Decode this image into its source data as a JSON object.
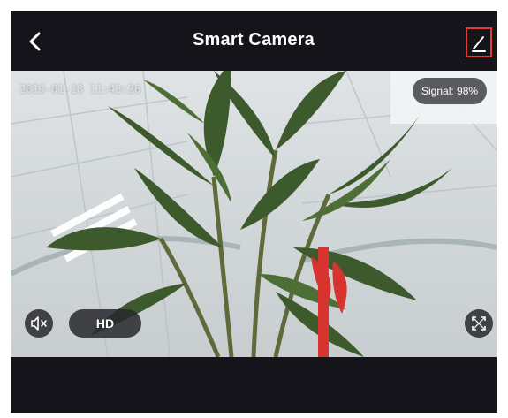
{
  "header": {
    "title": "Smart Camera",
    "back_icon": "chevron-left-icon",
    "edit_icon": "pencil-icon",
    "edit_highlight_color": "#e53935"
  },
  "video": {
    "timestamp": "2019-01-18 11:43:26",
    "signal": "Signal: 98%",
    "controls": {
      "mute_icon": "speaker-muted-icon",
      "quality_label": "HD",
      "fullscreen_icon": "fullscreen-icon"
    }
  },
  "colors": {
    "bar_background": "#16141b",
    "control_background": "#28282d",
    "text": "#ffffff"
  }
}
